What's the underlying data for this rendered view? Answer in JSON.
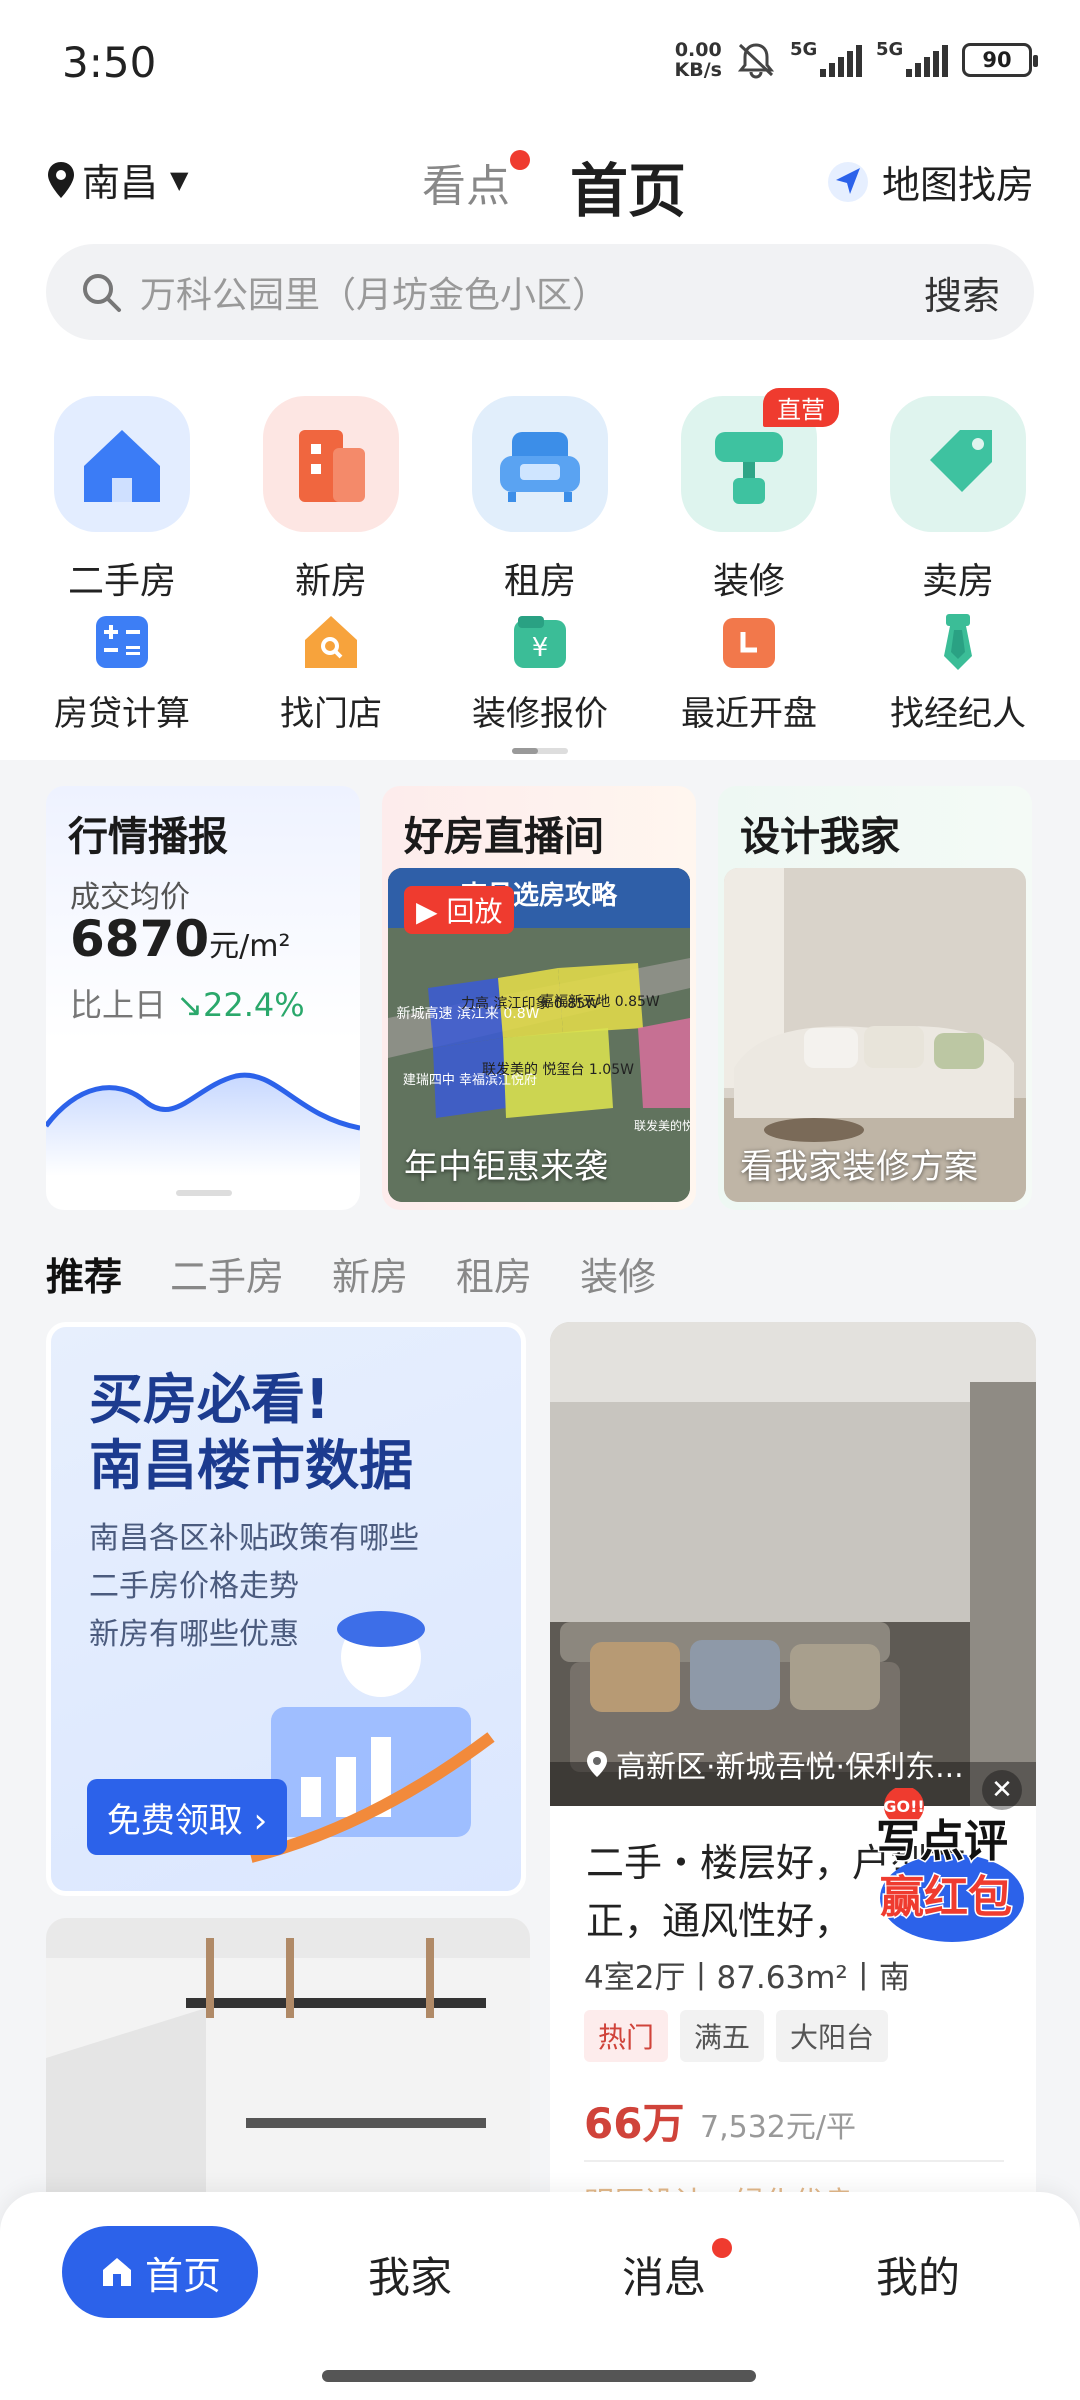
{
  "status_bar": {
    "time": "3:50",
    "net_speed_value": "0.00",
    "net_speed_unit": "KB/s",
    "signal1": "5G",
    "signal2": "5G",
    "battery": "90"
  },
  "header": {
    "city": "南昌",
    "tab_kandian": "看点",
    "tab_home": "首页",
    "map_find": "地图找房"
  },
  "search": {
    "placeholder": "万科公园里（月坊金色小区）",
    "button": "搜索"
  },
  "main_icons": [
    {
      "label": "二手房",
      "icon": "house-icon"
    },
    {
      "label": "新房",
      "icon": "building-icon"
    },
    {
      "label": "租房",
      "icon": "sofa-icon"
    },
    {
      "label": "装修",
      "icon": "paint-roller-icon",
      "badge": "直营"
    },
    {
      "label": "卖房",
      "icon": "price-tag-icon"
    }
  ],
  "sub_icons": [
    {
      "label": "房贷计算",
      "icon": "calculator-icon"
    },
    {
      "label": "找门店",
      "icon": "store-search-icon"
    },
    {
      "label": "装修报价",
      "icon": "quote-icon"
    },
    {
      "label": "最近开盘",
      "icon": "calendar-icon"
    },
    {
      "label": "找经纪人",
      "icon": "tie-icon"
    }
  ],
  "cards": {
    "market": {
      "title": "行情播报",
      "avg_label": "成交均价",
      "avg_value": "6870",
      "avg_unit": "元/m²",
      "compare_label": "比上日",
      "compare_value": "22.4%"
    },
    "live": {
      "title": "好房直播间",
      "replay": "回放",
      "caption": "年中钜惠来袭",
      "overlay_title": "南昌选房攻略",
      "map_labels": [
        "新城高速 滨江来 0.8W",
        "力高 滨江印象 0.85W",
        "嘉福新天地 0.85W",
        "建瑞四中 幸福滨江悦府",
        "联发美的 悦玺台 1.05W",
        "联发美的悦"
      ]
    },
    "design": {
      "title": "设计我家",
      "caption": "看我家装修方案"
    }
  },
  "rec_tabs": [
    "推荐",
    "二手房",
    "新房",
    "租房",
    "装修"
  ],
  "promo": {
    "line1": "买房必看!",
    "line2": "南昌楼市数据",
    "items": [
      "南昌各区补贴政策有哪些",
      "二手房价格走势",
      "新房有哪些优惠"
    ],
    "cta": "免费领取 ›"
  },
  "listing": {
    "location": "高新区·新城吾悦·保利东...",
    "title": "二手・楼层好，户型方正，通风性好，",
    "specs": "4室2厅丨87.63m²丨南",
    "tags": [
      "热门",
      "满五",
      "大阳台"
    ],
    "price": "66万",
    "unit_price": "7,532元/平",
    "review_badge_top": "GO!!",
    "review_line1": "写点评",
    "review_line2": "赢红包",
    "peek": "明厨设计，绿化优良"
  },
  "bottom_nav": {
    "home": "首页",
    "myhome": "我家",
    "messages": "消息",
    "me": "我的"
  },
  "colors": {
    "accent": "#2c62ea",
    "red": "#ef3b2f",
    "price": "#d0433a",
    "green": "#2aa86b"
  }
}
